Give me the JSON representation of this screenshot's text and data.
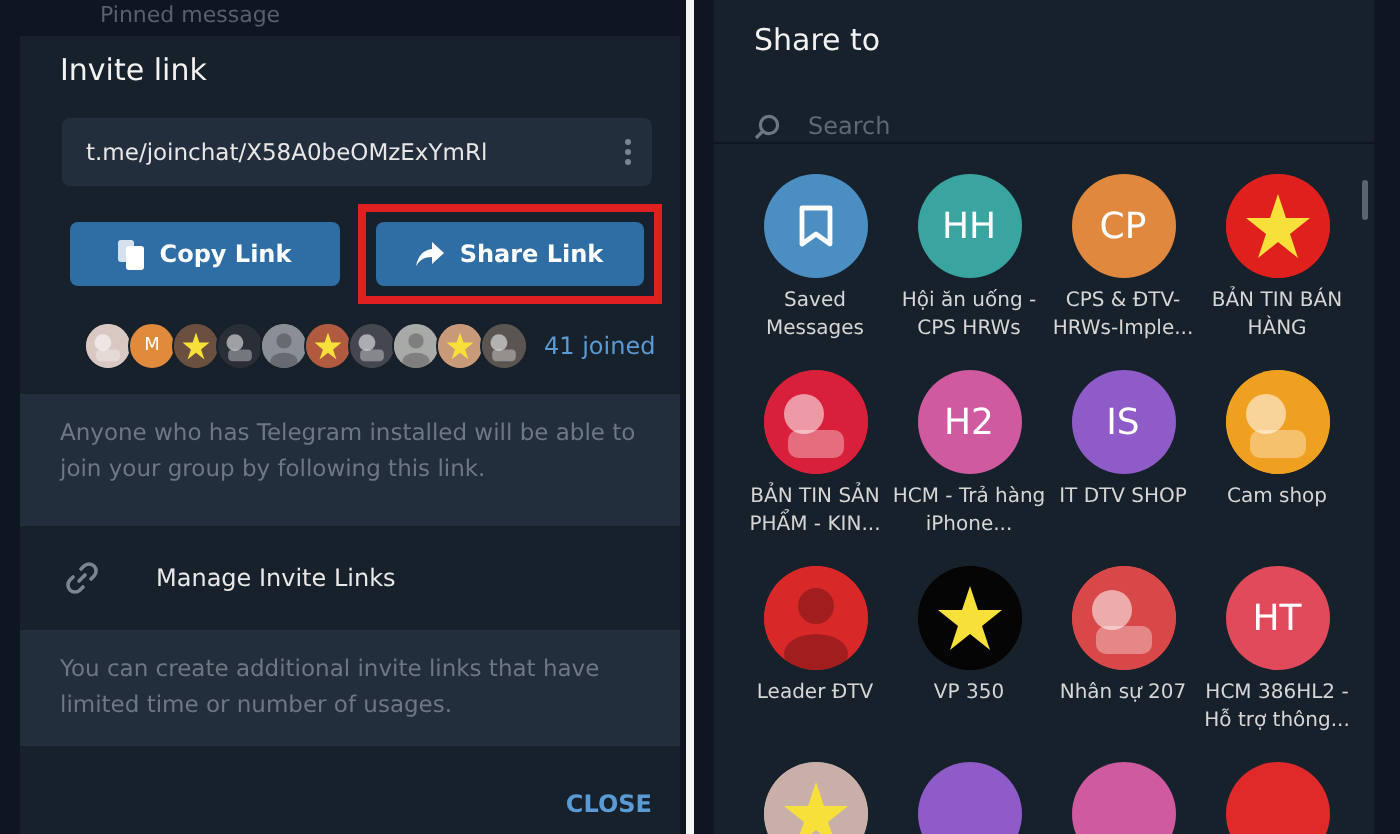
{
  "background": {
    "pinned_label": "Pinned message"
  },
  "invite_dialog": {
    "title": "Invite link",
    "link": "t.me/joinchat/X58A0beOMzExYmRl",
    "buttons": [
      {
        "label": "Copy Link",
        "kind": "copy",
        "highlighted": false
      },
      {
        "label": "Share Link",
        "kind": "share",
        "highlighted": true
      }
    ],
    "avatars": [
      {
        "kind": "picture",
        "color": "#d9c7c2"
      },
      {
        "kind": "letter",
        "letter": "M",
        "color": "#e08a3c"
      },
      {
        "kind": "picture",
        "color": "#6b5040"
      },
      {
        "kind": "picture",
        "color": "#2a2e35"
      },
      {
        "kind": "picture",
        "color": "#8a8f96"
      },
      {
        "kind": "picture",
        "color": "#b05a40"
      },
      {
        "kind": "picture",
        "color": "#44484e"
      },
      {
        "kind": "picture",
        "color": "#a8aaa8"
      },
      {
        "kind": "picture",
        "color": "#c99a7a"
      },
      {
        "kind": "picture",
        "color": "#5a5550"
      }
    ],
    "joined": "41 joined",
    "info": "Anyone who has Telegram installed will be able to join your group by following this link.",
    "manage": "Manage Invite Links",
    "manage_info": "You can create additional invite links that have limited time or number of usages.",
    "close": "CLOSE"
  },
  "share_dialog": {
    "title": "Share to",
    "search": {
      "placeholder": "Search"
    },
    "chats": [
      {
        "kind": "saved",
        "name": "Saved Messages",
        "color": "#4a8ec2"
      },
      {
        "kind": "initials",
        "initials": "HH",
        "name": "Hội ăn uống - CPS HRWs",
        "color": "#3aa5a0"
      },
      {
        "kind": "initials",
        "initials": "CP",
        "name": "CPS & ĐTV-HRWs-Imple...",
        "color": "#e0883e"
      },
      {
        "kind": "picture",
        "name": "BẢN TIN BÁN HÀNG",
        "color": "#e0201c"
      },
      {
        "kind": "picture",
        "name": "BẢN TIN SẢN PHẨM - KIN...",
        "color": "#d8203a"
      },
      {
        "kind": "initials",
        "initials": "H2",
        "name": "HCM - Trả hàng iPhone...",
        "color": "#d05aa0"
      },
      {
        "kind": "initials",
        "initials": "IS",
        "name": "IT DTV SHOP",
        "color": "#8e5bc8"
      },
      {
        "kind": "picture",
        "name": "Cam shop",
        "color": "#f0a020"
      },
      {
        "kind": "picture",
        "name": "Leader ĐTV",
        "color": "#d82828"
      },
      {
        "kind": "picture",
        "name": "VP 350",
        "color": "#050505"
      },
      {
        "kind": "picture",
        "name": "Nhân sự 207",
        "color": "#d84848"
      },
      {
        "kind": "initials",
        "initials": "HT",
        "name": "HCM 386HL2 - Hỗ trợ thông...",
        "color": "#e04a5a"
      },
      {
        "kind": "picture",
        "color": "#c8b0a8"
      },
      {
        "kind": "blank",
        "color": "#8e5bc8"
      },
      {
        "kind": "blank",
        "color": "#d05aa0"
      },
      {
        "kind": "blank",
        "color": "#e02a2a"
      }
    ]
  }
}
